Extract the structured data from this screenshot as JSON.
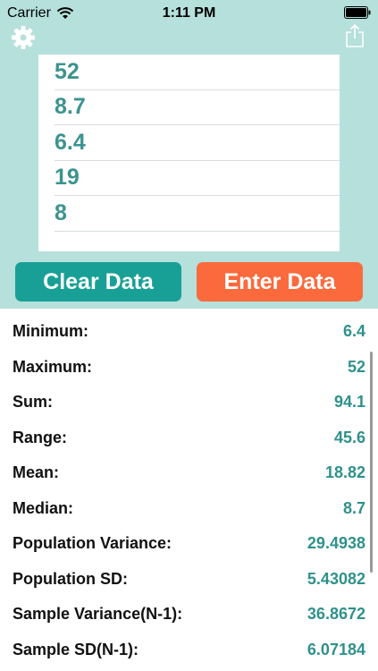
{
  "status_bar": {
    "carrier": "Carrier",
    "time": "1:11 PM"
  },
  "data_entries": [
    "52",
    "8.7",
    "6.4",
    "19",
    "8"
  ],
  "buttons": {
    "clear": "Clear Data",
    "enter": "Enter Data"
  },
  "stats": [
    {
      "label": "Minimum:",
      "value": "6.4"
    },
    {
      "label": "Maximum:",
      "value": "52"
    },
    {
      "label": "Sum:",
      "value": "94.1"
    },
    {
      "label": "Range:",
      "value": "45.6"
    },
    {
      "label": "Mean:",
      "value": "18.82"
    },
    {
      "label": "Median:",
      "value": "8.7"
    },
    {
      "label": "Population Variance:",
      "value": "29.4938"
    },
    {
      "label": "Population SD:",
      "value": "5.43082"
    },
    {
      "label": "Sample Variance(N-1):",
      "value": "36.8672"
    },
    {
      "label": "Sample SD(N-1):",
      "value": "6.07184"
    }
  ],
  "colors": {
    "header_bg": "#b5e0db",
    "accent_teal": "#19a096",
    "accent_orange": "#fa6a3c",
    "value_text": "#2f918b"
  },
  "icons": {
    "settings": "gear-icon",
    "share": "share-icon"
  }
}
